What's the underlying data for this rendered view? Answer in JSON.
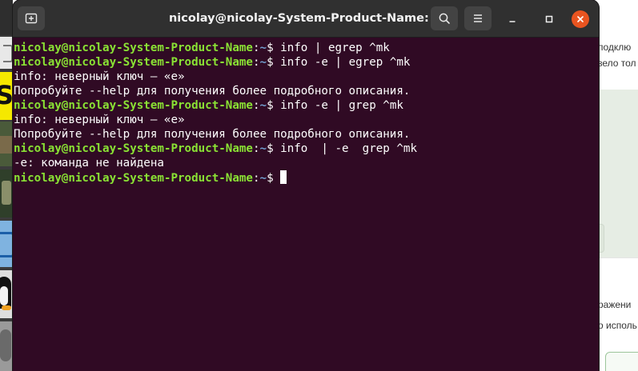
{
  "window": {
    "title": "nicolay@nicolay-System-Product-Name: ~"
  },
  "headerbar": {
    "new_tab_icon": "new-tab-icon",
    "search_icon": "search-icon",
    "menu_icon": "hamburger-menu-icon",
    "minimize_icon": "minimize-icon",
    "maximize_icon": "maximize-icon",
    "close_icon": "close-icon"
  },
  "prompt": {
    "user": "nicolay@nicolay-System-Product-Name",
    "separator": ":",
    "path": "~",
    "sign": "$ "
  },
  "terminal": {
    "lines": [
      {
        "type": "command",
        "text": "info | egrep ^mk"
      },
      {
        "type": "command",
        "text": "info -e | egrep ^mk"
      },
      {
        "type": "output",
        "text": "info: неверный ключ — «e»"
      },
      {
        "type": "output",
        "text": "Попробуйте --help для получения более подробного описания."
      },
      {
        "type": "command",
        "text": "info -e | grep ^mk"
      },
      {
        "type": "output",
        "text": "info: неверный ключ — «e»"
      },
      {
        "type": "output",
        "text": "Попробуйте --help для получения более подробного описания."
      },
      {
        "type": "command",
        "text": "info  | -e  grep ^mk"
      },
      {
        "type": "output",
        "text": "-e: команда не найдена"
      },
      {
        "type": "command",
        "text": "",
        "cursor": true
      }
    ]
  },
  "background": {
    "text_1": "подклю",
    "text_2": "зело тол",
    "text_3": "ражени",
    "text_4": "о исполь"
  },
  "colors": {
    "terminal_bg": "#300a24",
    "prompt_user": "#8ae234",
    "prompt_path": "#729fcf",
    "close_button": "#e95420",
    "headerbar_bg": "#303030"
  }
}
